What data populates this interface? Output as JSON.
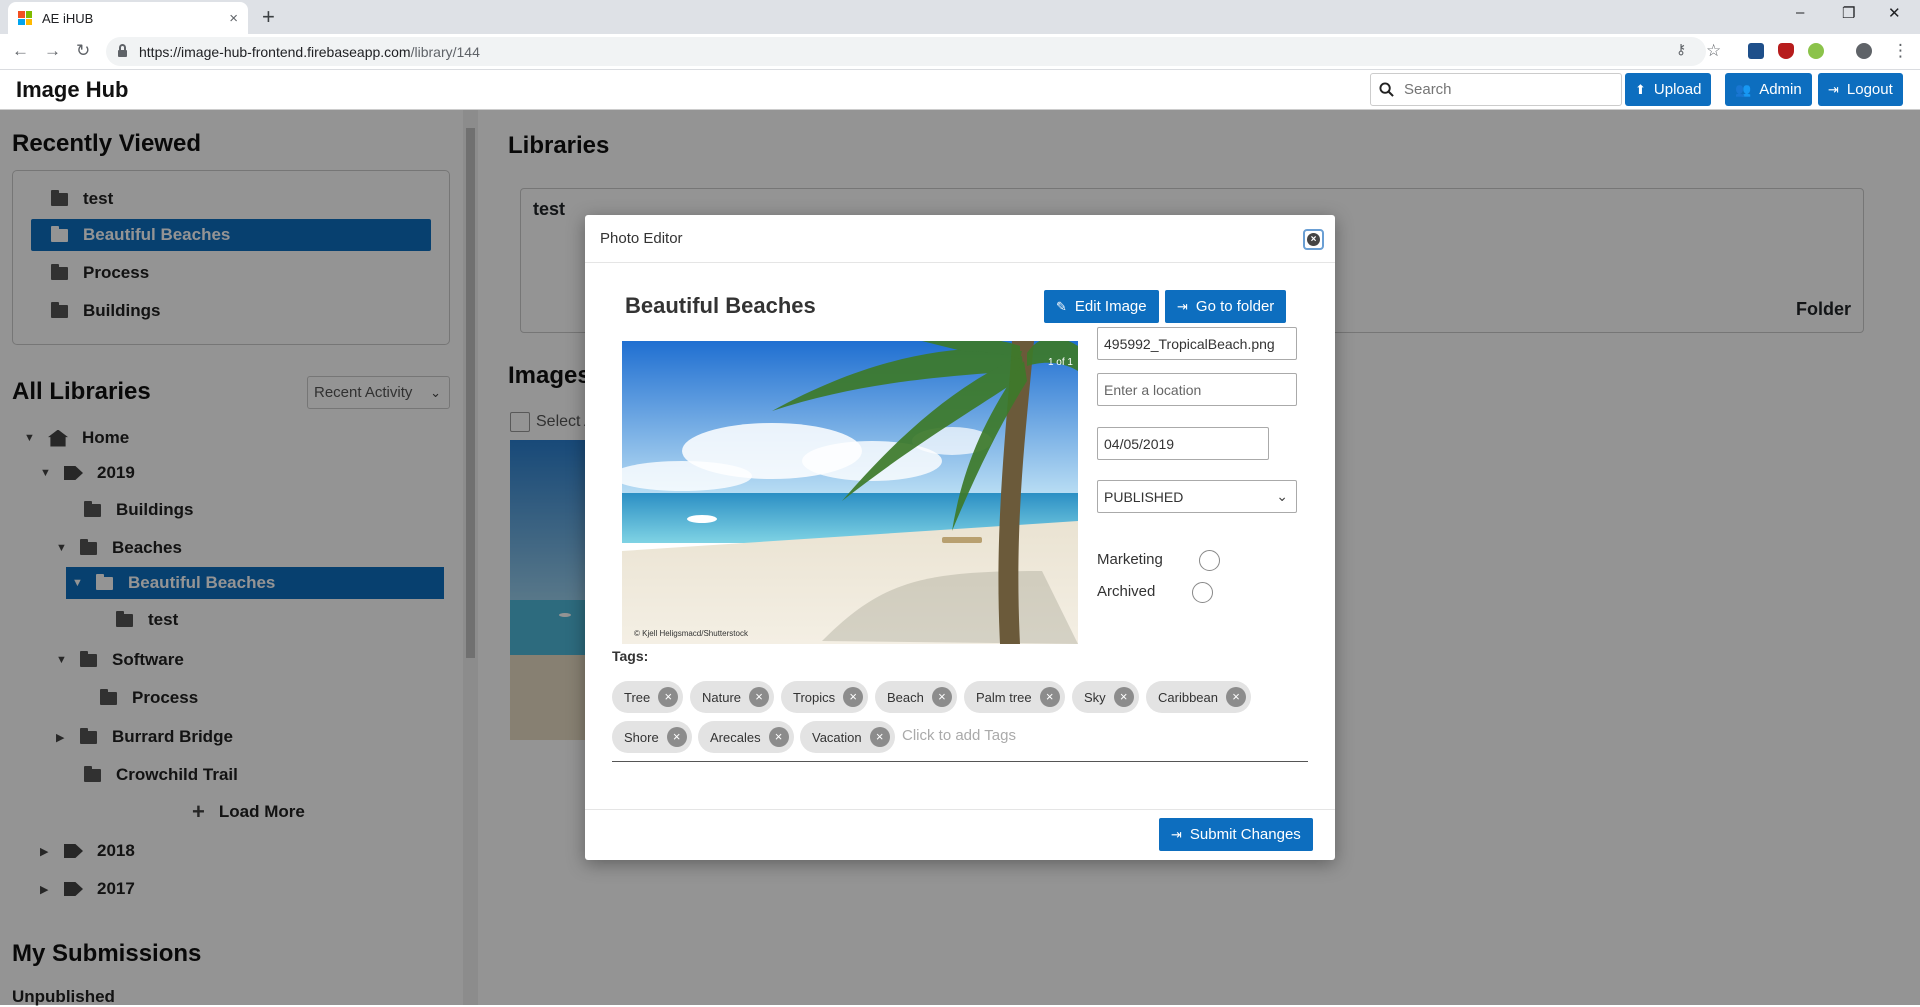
{
  "browser": {
    "tab_title": "AE iHUB",
    "tab_close": "×",
    "new_tab": "+",
    "url_host": "https://image-hub-frontend.firebaseapp.com",
    "url_path": "/library/144",
    "win_min": "–",
    "win_max": "❐",
    "win_close": "✕"
  },
  "header": {
    "brand": "Image Hub",
    "search_placeholder": "Search",
    "upload": "Upload",
    "admin": "Admin",
    "logout": "Logout"
  },
  "sidebar": {
    "recent_title": "Recently Viewed",
    "recent": [
      {
        "label": "test",
        "active": false
      },
      {
        "label": "Beautiful Beaches",
        "active": true
      },
      {
        "label": "Process",
        "active": false
      },
      {
        "label": "Buildings",
        "active": false
      }
    ],
    "all_title": "All Libraries",
    "sort_value": "Recent Activity",
    "tree": {
      "home": "Home",
      "y2019": "2019",
      "buildings": "Buildings",
      "beaches": "Beaches",
      "beautiful_beaches": "Beautiful Beaches",
      "test": "test",
      "software": "Software",
      "process": "Process",
      "burrard": "Burrard Bridge",
      "crowchild": "Crowchild Trail",
      "load_more": "Load More",
      "y2018": "2018",
      "y2017": "2017"
    },
    "submissions_title": "My Submissions",
    "unpublished": "Unpublished"
  },
  "main": {
    "libraries_title": "Libraries",
    "library_card": {
      "name": "test",
      "type": "Folder"
    },
    "images_title": "Images",
    "select_all": "Select All"
  },
  "modal": {
    "title": "Photo Editor",
    "photo_title": "Beautiful Beaches",
    "edit_image": "Edit Image",
    "go_to_folder": "Go to folder",
    "counter": "1 of 1",
    "credit": "© Kjell Heligsmacd/Shutterstock",
    "filename": "495992_TropicalBeach.png",
    "location_placeholder": "Enter a location",
    "date": "04/05/2019",
    "status": "PUBLISHED",
    "marketing_label": "Marketing",
    "archived_label": "Archived",
    "marketing_checked": false,
    "archived_checked": false,
    "tags_label": "Tags:",
    "tags": [
      "Tree",
      "Nature",
      "Tropics",
      "Beach",
      "Palm tree",
      "Sky",
      "Caribbean",
      "Shore",
      "Arecales",
      "Vacation"
    ],
    "tag_placeholder": "Click to add Tags",
    "submit": "Submit Changes"
  },
  "colors": {
    "primary": "#0d6ebf",
    "overlay": "rgba(0,0,0,0.42)",
    "chip": "#e3e3e3"
  },
  "icons": [
    "search-icon",
    "upload-icon",
    "admin-users-icon",
    "logout-icon",
    "folder-icon",
    "tag-icon",
    "home-icon",
    "pencil-icon",
    "go-to-folder-icon",
    "close-icon",
    "chevron-down-icon",
    "plus-icon"
  ]
}
